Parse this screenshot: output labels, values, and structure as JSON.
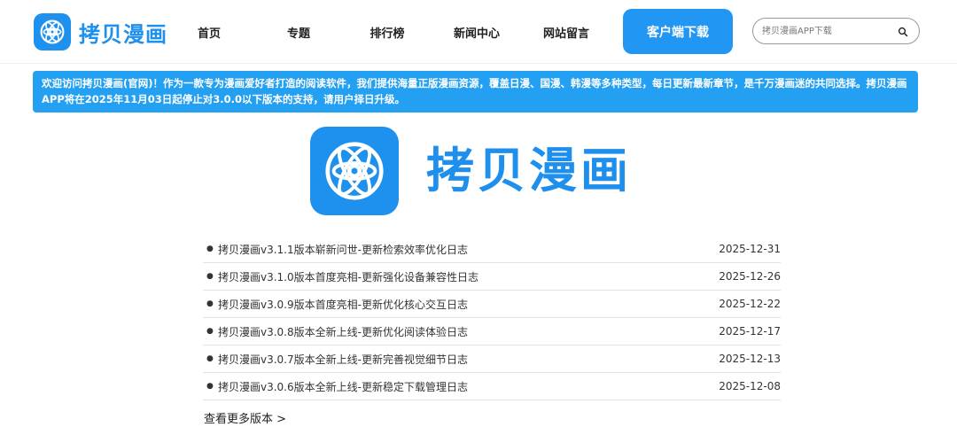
{
  "brand": {
    "name": "拷贝漫画"
  },
  "nav": {
    "items": [
      "首页",
      "专题",
      "排行榜",
      "新闻中心",
      "网站留言"
    ]
  },
  "header": {
    "download_label": "客户端下载"
  },
  "search": {
    "placeholder": "拷贝漫画APP下载"
  },
  "notice": {
    "text": "欢迎访问拷贝漫画(官网)！作为一款专为漫画爱好者打造的阅读软件，我们提供海量正版漫画资源，覆盖日漫、国漫、韩漫等多种类型，每日更新最新章节，是千万漫画迷的共同选择。拷贝漫画APP将在2025年11月03日起停止对3.0.0以下版本的支持，请用户择日升级。"
  },
  "hero": {
    "title": "拷贝漫画"
  },
  "versions": [
    {
      "title": "拷贝漫画v3.1.1版本崭新问世-更新检索效率优化日志",
      "date": "2025-12-31"
    },
    {
      "title": "拷贝漫画v3.1.0版本首度亮相-更新强化设备兼容性日志",
      "date": "2025-12-26"
    },
    {
      "title": "拷贝漫画v3.0.9版本首度亮相-更新优化核心交互日志",
      "date": "2025-12-22"
    },
    {
      "title": "拷贝漫画v3.0.8版本全新上线-更新优化阅读体验日志",
      "date": "2025-12-17"
    },
    {
      "title": "拷贝漫画v3.0.7版本全新上线-更新完善视觉细节日志",
      "date": "2025-12-13"
    },
    {
      "title": "拷贝漫画v3.0.6版本全新上线-更新稳定下载管理日志",
      "date": "2025-12-08"
    }
  ],
  "more": {
    "label": "查看更多版本 >"
  },
  "colors": {
    "brand": "#1e90ee",
    "accent": "#2196f3",
    "notice_bg": "#24a0f2"
  },
  "icons": {
    "logo": "atom-logo-icon",
    "search": "search-icon",
    "bullet": "bullet-icon"
  }
}
